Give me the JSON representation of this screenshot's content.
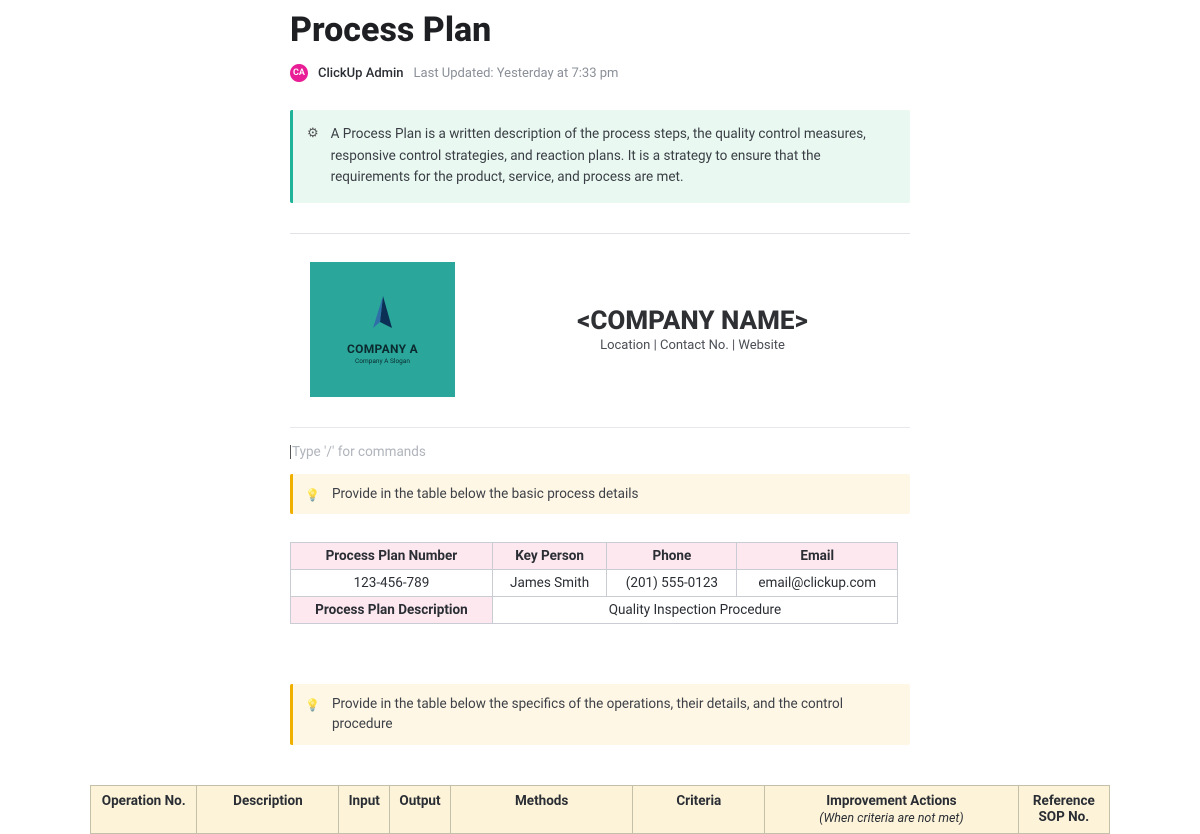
{
  "title": "Process Plan",
  "author": {
    "initials": "CA",
    "name": "ClickUp Admin"
  },
  "updated_label": "Last Updated: Yesterday at 7:33 pm",
  "intro": "A Process Plan is a written description of the process steps, the quality control measures, responsive control strategies, and reaction plans. It is a strategy to ensure that the requirements for the product, service, and process are met.",
  "logo": {
    "company": "COMPANY A",
    "slogan": "Company A Slogan"
  },
  "company": {
    "name": "<COMPANY NAME>",
    "subline": "Location | Contact No. | Website"
  },
  "slash_placeholder": "Type '/' for commands",
  "hint1": "Provide in the table below the basic process details",
  "details": {
    "headers": [
      "Process Plan Number",
      "Key Person",
      "Phone",
      "Email"
    ],
    "row": [
      "123-456-789",
      "James Smith",
      "(201) 555-0123",
      "email@clickup.com"
    ],
    "desc_label": "Process Plan Description",
    "desc_value": "Quality Inspection Procedure"
  },
  "hint2": "Provide in the table below the specifics of the operations, their details, and the control procedure",
  "ops_headers": {
    "c1": "Operation No.",
    "c2": "Description",
    "c3": "Input",
    "c4": "Output",
    "c5": "Methods",
    "c6": "Criteria",
    "c7": "Improvement Actions",
    "c7sub": "(When criteria are not met)",
    "c8": "Reference SOP No."
  }
}
